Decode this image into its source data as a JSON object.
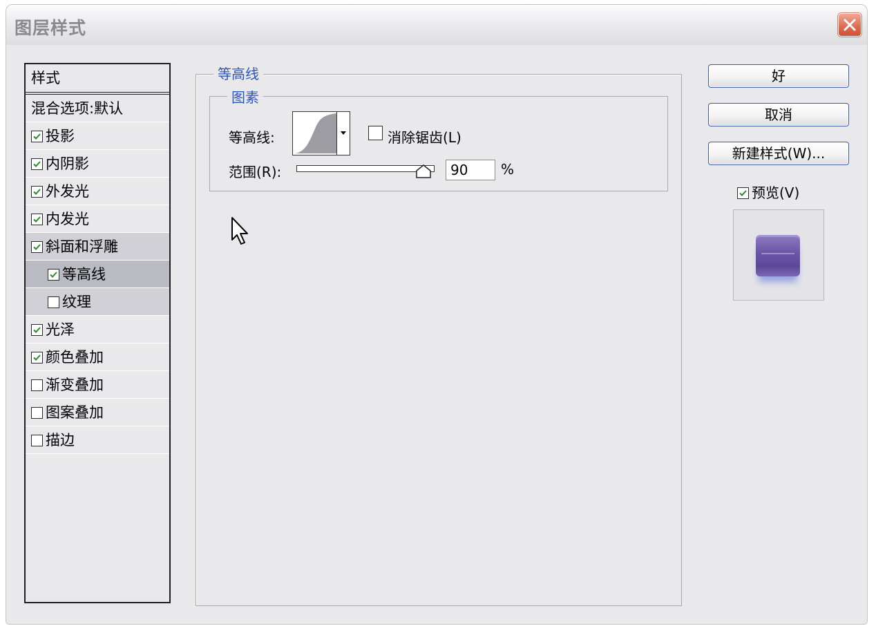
{
  "window": {
    "title": "图层样式"
  },
  "styles": {
    "header": "样式",
    "items": [
      {
        "label": "混合选项:默认",
        "checkbox": null
      },
      {
        "label": "投影",
        "checkbox": true
      },
      {
        "label": "内阴影",
        "checkbox": true
      },
      {
        "label": "外发光",
        "checkbox": true
      },
      {
        "label": "内发光",
        "checkbox": true
      },
      {
        "label": "斜面和浮雕",
        "checkbox": true
      },
      {
        "label": "等高线",
        "checkbox": true
      },
      {
        "label": "纹理",
        "checkbox": false
      },
      {
        "label": "光泽",
        "checkbox": true
      },
      {
        "label": "颜色叠加",
        "checkbox": true
      },
      {
        "label": "渐变叠加",
        "checkbox": false
      },
      {
        "label": "图案叠加",
        "checkbox": false
      },
      {
        "label": "描边",
        "checkbox": false
      }
    ]
  },
  "panel": {
    "group_title": "等高线",
    "subgroup_title": "图素",
    "contour_label": "等高线:",
    "antialias_label": "消除锯齿(L)",
    "antialias_checked": false,
    "range_label": "范围(R):",
    "range_value": "90",
    "range_unit": "%"
  },
  "buttons": {
    "ok": "好",
    "cancel": "取消",
    "new_style": "新建样式(W)...",
    "preview_label": "预览(V)",
    "preview_checked": true
  },
  "colors": {
    "accent_text": "#2e55b8",
    "preview_swatch": "#6d58a8",
    "close_button": "#dd6a4f"
  },
  "icons": {
    "close": "close-icon",
    "check": "checkmark-icon",
    "dropdown": "chevron-down-icon",
    "cursor": "mouse-pointer-icon"
  }
}
